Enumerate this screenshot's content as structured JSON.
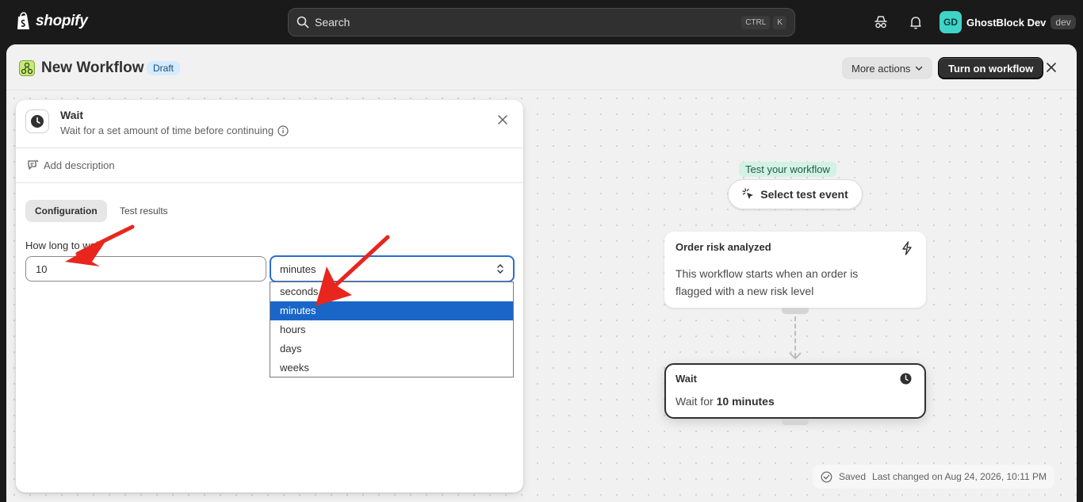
{
  "topbar": {
    "brand": "shopify",
    "search_placeholder": "Search",
    "kbd_ctrl": "CTRL",
    "kbd_k": "K",
    "user_initials": "GD",
    "user_name": "GhostBlock Dev",
    "dev_badge": "dev"
  },
  "header": {
    "title": "New Workflow",
    "status": "Draft",
    "more_actions": "More actions",
    "turn_on": "Turn on workflow"
  },
  "panel": {
    "title": "Wait",
    "subtitle": "Wait for a set amount of time before continuing",
    "add_description": "Add description",
    "tabs": [
      "Configuration",
      "Test results"
    ],
    "field_label": "How long to wait",
    "field_value": "10",
    "unit_selected": "minutes",
    "unit_options": [
      "seconds",
      "minutes",
      "hours",
      "days",
      "weeks"
    ]
  },
  "flow": {
    "test_label": "Test your workflow",
    "test_button": "Select test event",
    "trigger_title": "Order risk analyzed",
    "trigger_body": "This workflow starts when an order is flagged with a new risk level",
    "wait_title": "Wait",
    "wait_prefix": "Wait for ",
    "wait_value": "10 minutes"
  },
  "status_bar": {
    "saved": "Saved",
    "last_changed": "Last changed on Aug 24, 2026, 10:11 PM"
  },
  "colors": {
    "accent": "#2c6ecb",
    "selected_option": "#1a66c8",
    "annotation_arrow": "#e8261e"
  }
}
